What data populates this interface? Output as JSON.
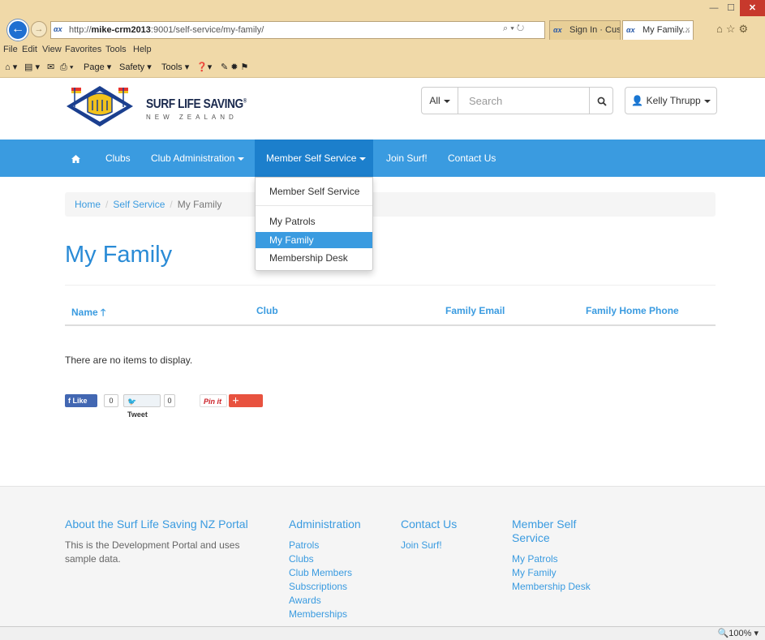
{
  "browser": {
    "address_scheme": "http://",
    "address_host": "mike-crm2013",
    "address_rest": ":9001/self-service/my-family/",
    "address_search_glyph": "⌕ ▾ ↻",
    "tabs": [
      {
        "label": "Sign In · Cust...",
        "favicon": "αx"
      },
      {
        "label": "My Family...",
        "favicon": "αx",
        "close": "×"
      }
    ],
    "menu": [
      "File",
      "Edit",
      "View",
      "Favorites",
      "Tools",
      "Help"
    ],
    "commands": [
      "Page ▾",
      "Safety ▾",
      "Tools ▾"
    ],
    "zoom": "100%",
    "window_controls": {
      "min": "—",
      "max": "☐",
      "close": "✕"
    }
  },
  "header": {
    "brand_title": "SURF LIFE SAVING",
    "brand_sub": "NEW ZEALAND",
    "search_scope": "All",
    "search_placeholder": "Search",
    "search_value": "",
    "user_name": "Kelly Thrupp"
  },
  "nav": {
    "home_icon": "home-icon",
    "items": [
      {
        "label": "Clubs"
      },
      {
        "label": "Club Administration"
      },
      {
        "label": "Member Self Service"
      },
      {
        "label": "Join Surf!"
      },
      {
        "label": "Contact Us"
      }
    ],
    "dropdown": {
      "header_item": "Member Self Service",
      "items": [
        "My Patrols",
        "My Family",
        "Membership Desk"
      ],
      "active": "My Family"
    }
  },
  "breadcrumb": {
    "home": "Home",
    "self_service": "Self Service",
    "current": "My Family",
    "separator": "/"
  },
  "main": {
    "title": "My Family",
    "columns": [
      "Name",
      "Club",
      "Family Email",
      "Family Home Phone"
    ],
    "sort_indicator": "🡑",
    "empty_message": "There are no items to display."
  },
  "social": {
    "like": "Like",
    "like_count": "0",
    "tweet": "Tweet",
    "tweet_count": "0",
    "pinit": "Pin it",
    "share": "Share"
  },
  "footer": {
    "about_title": "About the Surf Life Saving NZ Portal",
    "about_text_1": "This is the Development Portal and uses",
    "about_text_2": "sample data.",
    "admin_title": "Administration",
    "admin_links": [
      "Patrols",
      "Clubs",
      "Club Members",
      "Subscriptions",
      "Awards",
      "Memberships"
    ],
    "contact_title": "Contact Us",
    "contact_links": [
      "Join Surf!"
    ],
    "mss_title_1": "Member Self",
    "mss_title_2": "Service",
    "mss_links": [
      "My Patrols",
      "My Family",
      "Membership Desk"
    ]
  },
  "colors": {
    "primary": "#3a9be0",
    "nav_active": "#1c7fcc",
    "title": "#2a8bd6"
  }
}
